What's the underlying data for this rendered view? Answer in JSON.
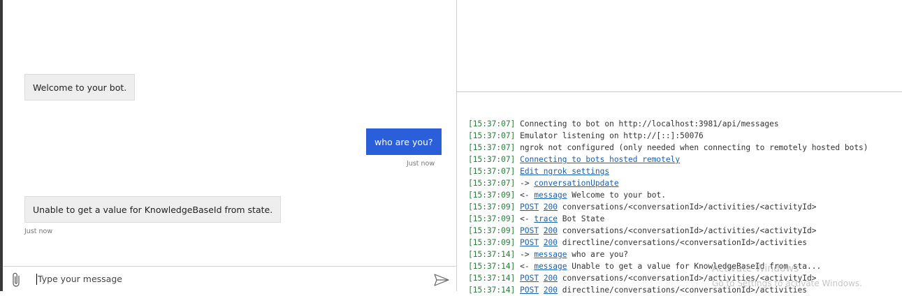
{
  "chat": {
    "messages": [
      {
        "from": "bot",
        "text": "Welcome to your bot.",
        "time": ""
      },
      {
        "from": "user",
        "text": "who are you?",
        "time": "Just now"
      },
      {
        "from": "bot",
        "text": "Unable to get a value for KnowledgeBaseId from state.",
        "time": "Just now"
      }
    ],
    "input_placeholder": "Type your message",
    "attach_icon": "paperclip-icon",
    "send_icon": "send-icon"
  },
  "log": [
    {
      "time": "[15:37:07]",
      "parts": [
        {
          "t": "Connecting to bot on http://localhost:3981/api/messages"
        }
      ]
    },
    {
      "time": "[15:37:07]",
      "parts": [
        {
          "t": "Emulator listening on http://[::]:50076"
        }
      ]
    },
    {
      "time": "[15:37:07]",
      "parts": [
        {
          "t": "ngrok not configured (only needed when connecting to remotely hosted bots)"
        }
      ]
    },
    {
      "time": "[15:37:07]",
      "parts": [
        {
          "t": "Connecting to bots hosted remotely",
          "link": true
        }
      ]
    },
    {
      "time": "[15:37:07]",
      "parts": [
        {
          "t": "Edit ngrok settings",
          "link": true
        }
      ]
    },
    {
      "time": "[15:37:07]",
      "parts": [
        {
          "t": "-> "
        },
        {
          "t": "conversationUpdate",
          "link": true
        }
      ]
    },
    {
      "time": "[15:37:09]",
      "parts": [
        {
          "t": "<- "
        },
        {
          "t": "message",
          "link": true
        },
        {
          "t": " Welcome to your bot."
        }
      ]
    },
    {
      "time": "[15:37:09]",
      "parts": [
        {
          "t": "POST",
          "link": true
        },
        {
          "t": " "
        },
        {
          "t": "200",
          "link": true
        },
        {
          "t": " conversations/<conversationId>/activities/<activityId>"
        }
      ]
    },
    {
      "time": "[15:37:09]",
      "parts": [
        {
          "t": "<- "
        },
        {
          "t": "trace",
          "link": true
        },
        {
          "t": " Bot State"
        }
      ]
    },
    {
      "time": "[15:37:09]",
      "parts": [
        {
          "t": "POST",
          "link": true
        },
        {
          "t": " "
        },
        {
          "t": "200",
          "link": true
        },
        {
          "t": " conversations/<conversationId>/activities/<activityId>"
        }
      ]
    },
    {
      "time": "[15:37:09]",
      "parts": [
        {
          "t": "POST",
          "link": true
        },
        {
          "t": " "
        },
        {
          "t": "200",
          "link": true
        },
        {
          "t": " directline/conversations/<conversationId>/activities"
        }
      ]
    },
    {
      "time": "[15:37:14]",
      "parts": [
        {
          "t": "-> "
        },
        {
          "t": "message",
          "link": true
        },
        {
          "t": " who are you?"
        }
      ]
    },
    {
      "time": "[15:37:14]",
      "parts": [
        {
          "t": "<- "
        },
        {
          "t": "message",
          "link": true
        },
        {
          "t": " Unable to get a value for KnowledgeBaseId from sta..."
        }
      ]
    },
    {
      "time": "[15:37:14]",
      "parts": [
        {
          "t": "POST",
          "link": true
        },
        {
          "t": " "
        },
        {
          "t": "200",
          "link": true
        },
        {
          "t": " conversations/<conversationId>/activities/<activityId>"
        }
      ]
    },
    {
      "time": "[15:37:14]",
      "parts": [
        {
          "t": "POST",
          "link": true
        },
        {
          "t": " "
        },
        {
          "t": "200",
          "link": true
        },
        {
          "t": " directline/conversations/<conversationId>/activities"
        }
      ]
    }
  ],
  "watermark": {
    "line1": "Activate Windows",
    "line2": "Go to Settings to activate Windows."
  },
  "colors": {
    "user_bubble": "#2b5fd9",
    "bot_bubble": "#eeeeee",
    "log_time": "#2a7a3a",
    "link": "#1a5fb4"
  }
}
